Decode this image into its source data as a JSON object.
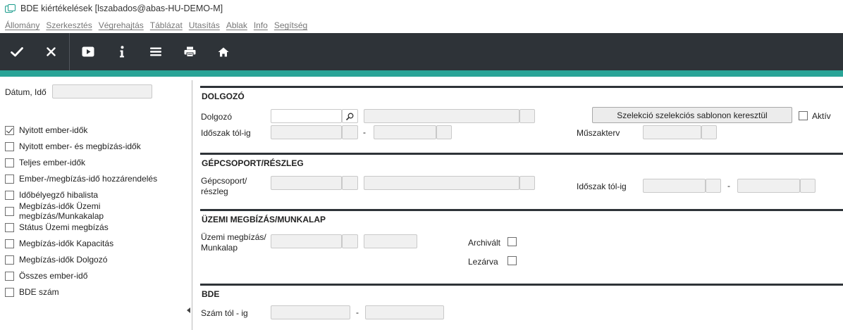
{
  "window": {
    "title": "BDE kiértékelések  [lszabados@abas-HU-DEMO-M]"
  },
  "menu": [
    "Állomány",
    "Szerkesztés",
    "Végrehajtás",
    "Táblázat",
    "Utasítás",
    "Ablak",
    "Info",
    "Segítség"
  ],
  "toolbar": {
    "icons": [
      "check-icon",
      "close-icon",
      "play-icon",
      "info-icon",
      "menu-icon",
      "print-icon",
      "home-icon"
    ]
  },
  "colors": {
    "toolbar_bg": "#2e3338",
    "accent": "#29a497"
  },
  "left": {
    "datetime_label": "Dátum, Idő",
    "datetime_value": "",
    "options": [
      {
        "label": "Nyitott ember-idők",
        "checked": true
      },
      {
        "label": "Nyitott ember- és megbízás-idők",
        "checked": false
      },
      {
        "label": "Teljes ember-idők",
        "checked": false
      },
      {
        "label": "Ember-/megbízás-idő hozzárendelés",
        "checked": false
      },
      {
        "label": "Időbélyegző hibalista",
        "checked": false
      },
      {
        "label": "Megbízás-idők Üzemi megbízás/Munkakalap",
        "checked": false
      },
      {
        "label": "Státus Üzemi megbízás",
        "checked": false
      },
      {
        "label": "Megbízás-idők Kapacitás",
        "checked": false
      },
      {
        "label": "Megbízás-idők Dolgozó",
        "checked": false
      },
      {
        "label": "Összes ember-idő",
        "checked": false
      },
      {
        "label": "BDE szám",
        "checked": false
      }
    ]
  },
  "sections": {
    "dolgozo": {
      "title": "DOLGOZÓ",
      "employee_label": "Dolgozó",
      "period_label": "Időszak tól-ig",
      "dash": "-",
      "template_button": "Szelekció szelekciós sablonon keresztül",
      "active_label": "Aktív",
      "shift_label": "Műszakterv"
    },
    "gepcsoport": {
      "title": "GÉPCSOPORT/RÉSZLEG",
      "group_label_1": "Gépcsoport/",
      "group_label_2": "részleg",
      "period_label": "Időszak tól-ig",
      "dash": "-"
    },
    "uzemi": {
      "title": "ÜZEMI MEGBÍZÁS/MUNKALAP",
      "order_label_1": "Üzemi megbízás/",
      "order_label_2": "Munkalap",
      "archived_label": "Archivált",
      "closed_label": "Lezárva"
    },
    "bde": {
      "title": "BDE",
      "number_label": "Szám tól - ig",
      "dash": "-"
    }
  }
}
